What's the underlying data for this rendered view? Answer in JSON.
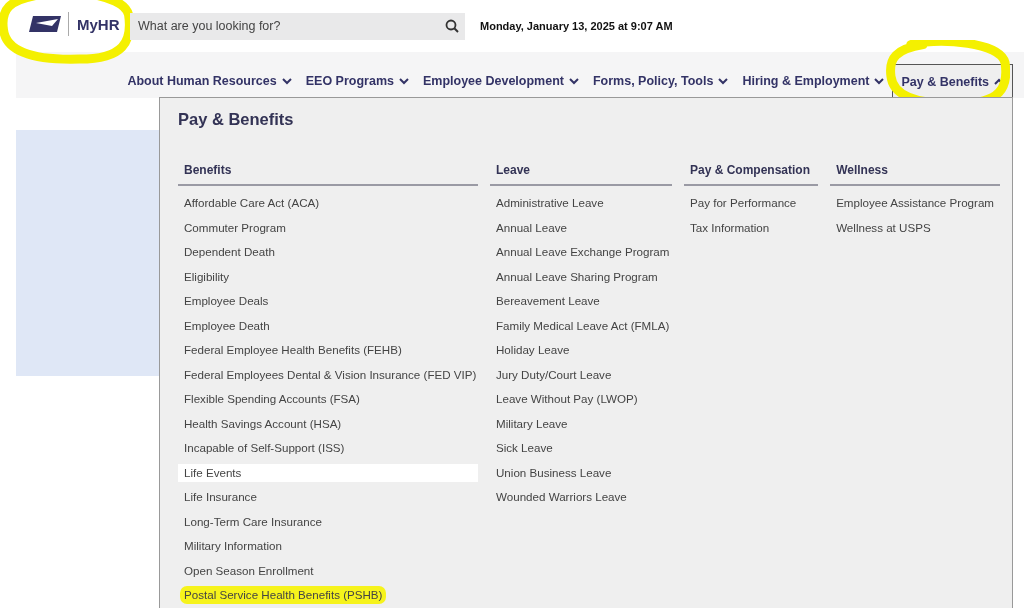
{
  "header": {
    "logo": {
      "label": "MyHR",
      "highlighted": true
    },
    "search": {
      "placeholder": "What are you looking for?"
    },
    "datetime": "Monday, January 13, 2025 at 9:07 AM"
  },
  "nav": [
    {
      "label": "About Human Resources",
      "expanded": false,
      "highlighted": false
    },
    {
      "label": "EEO Programs",
      "expanded": false,
      "highlighted": false
    },
    {
      "label": "Employee Development",
      "expanded": false,
      "highlighted": false
    },
    {
      "label": "Forms, Policy, Tools",
      "expanded": false,
      "highlighted": false
    },
    {
      "label": "Hiring & Employment",
      "expanded": false,
      "highlighted": false
    },
    {
      "label": "Pay & Benefits",
      "expanded": true,
      "highlighted": true
    }
  ],
  "menu": {
    "title": "Pay & Benefits",
    "columns": [
      {
        "heading": "Benefits",
        "items": [
          {
            "label": "Affordable Care Act (ACA)",
            "selected": false,
            "highlighted": false
          },
          {
            "label": "Commuter Program",
            "selected": false,
            "highlighted": false
          },
          {
            "label": "Dependent Death",
            "selected": false,
            "highlighted": false
          },
          {
            "label": "Eligibility",
            "selected": false,
            "highlighted": false
          },
          {
            "label": "Employee Deals",
            "selected": false,
            "highlighted": false
          },
          {
            "label": "Employee Death",
            "selected": false,
            "highlighted": false
          },
          {
            "label": "Federal Employee Health Benefits (FEHB)",
            "selected": false,
            "highlighted": false
          },
          {
            "label": "Federal Employees Dental & Vision Insurance (FED VIP)",
            "selected": false,
            "highlighted": false
          },
          {
            "label": "Flexible Spending Accounts (FSA)",
            "selected": false,
            "highlighted": false
          },
          {
            "label": "Health Savings Account (HSA)",
            "selected": false,
            "highlighted": false
          },
          {
            "label": "Incapable of Self-Support (ISS)",
            "selected": false,
            "highlighted": false
          },
          {
            "label": "Life Events",
            "selected": true,
            "highlighted": false
          },
          {
            "label": "Life Insurance",
            "selected": false,
            "highlighted": false
          },
          {
            "label": "Long-Term Care Insurance",
            "selected": false,
            "highlighted": false
          },
          {
            "label": "Military Information",
            "selected": false,
            "highlighted": false
          },
          {
            "label": "Open Season Enrollment",
            "selected": false,
            "highlighted": false
          },
          {
            "label": "Postal Service Health Benefits (PSHB)",
            "selected": false,
            "highlighted": true
          }
        ]
      },
      {
        "heading": "Leave",
        "items": [
          {
            "label": "Administrative Leave",
            "selected": false,
            "highlighted": false
          },
          {
            "label": "Annual Leave",
            "selected": false,
            "highlighted": false
          },
          {
            "label": "Annual Leave Exchange Program",
            "selected": false,
            "highlighted": false
          },
          {
            "label": "Annual Leave Sharing Program",
            "selected": false,
            "highlighted": false
          },
          {
            "label": "Bereavement Leave",
            "selected": false,
            "highlighted": false
          },
          {
            "label": "Family Medical Leave Act (FMLA)",
            "selected": false,
            "highlighted": false
          },
          {
            "label": "Holiday Leave",
            "selected": false,
            "highlighted": false
          },
          {
            "label": "Jury Duty/Court Leave",
            "selected": false,
            "highlighted": false
          },
          {
            "label": "Leave Without Pay (LWOP)",
            "selected": false,
            "highlighted": false
          },
          {
            "label": "Military Leave",
            "selected": false,
            "highlighted": false
          },
          {
            "label": "Sick Leave",
            "selected": false,
            "highlighted": false
          },
          {
            "label": "Union Business Leave",
            "selected": false,
            "highlighted": false
          },
          {
            "label": "Wounded Warriors Leave",
            "selected": false,
            "highlighted": false
          }
        ]
      },
      {
        "heading": "Pay & Compensation",
        "items": [
          {
            "label": "Pay for Performance",
            "selected": false,
            "highlighted": false
          },
          {
            "label": "Tax Information",
            "selected": false,
            "highlighted": false
          }
        ]
      },
      {
        "heading": "Wellness",
        "items": [
          {
            "label": "Employee Assistance Program",
            "selected": false,
            "highlighted": false
          },
          {
            "label": "Wellness at USPS",
            "selected": false,
            "highlighted": false
          }
        ]
      }
    ]
  }
}
